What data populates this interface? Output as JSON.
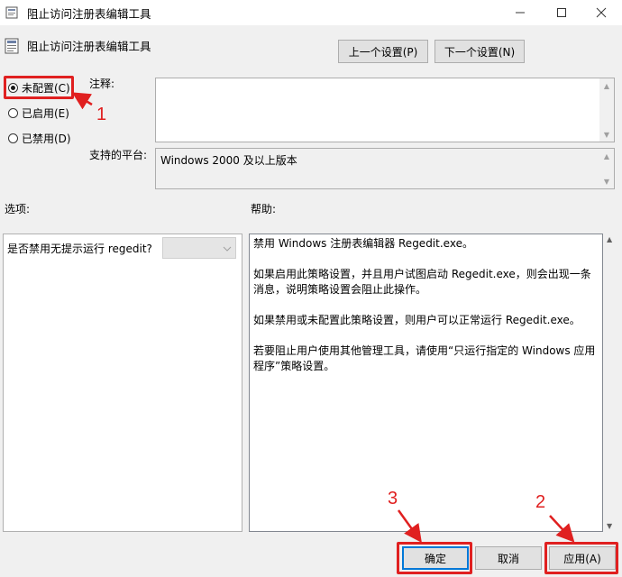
{
  "window": {
    "title": "阻止访问注册表编辑工具",
    "minimize": "—",
    "maximize": "☐",
    "close": "✕"
  },
  "header": {
    "policy_title": "阻止访问注册表编辑工具",
    "prev_setting": "上一个设置(P)",
    "next_setting": "下一个设置(N)"
  },
  "state": {
    "options": [
      {
        "label": "未配置(C)",
        "checked": true
      },
      {
        "label": "已启用(E)",
        "checked": false
      },
      {
        "label": "已禁用(D)",
        "checked": false
      }
    ]
  },
  "comment": {
    "label": "注释:",
    "value": ""
  },
  "platform": {
    "label": "支持的平台:",
    "value": "Windows 2000 及以上版本"
  },
  "options_section": {
    "label": "选项:",
    "question": "是否禁用无提示运行 regedit?",
    "dropdown_value": ""
  },
  "help_section": {
    "label": "帮助:",
    "text": "禁用 Windows 注册表编辑器 Regedit.exe。\n\n如果启用此策略设置，并且用户试图启动 Regedit.exe，则会出现一条消息，说明策略设置会阻止此操作。\n\n如果禁用或未配置此策略设置，则用户可以正常运行 Regedit.exe。\n\n若要阻止用户使用其他管理工具，请使用“只运行指定的 Windows 应用程序”策略设置。"
  },
  "footer": {
    "ok": "确定",
    "cancel": "取消",
    "apply": "应用(A)"
  },
  "annotations": {
    "step1": "1",
    "step2": "2",
    "step3": "3",
    "color": "#e02020"
  }
}
